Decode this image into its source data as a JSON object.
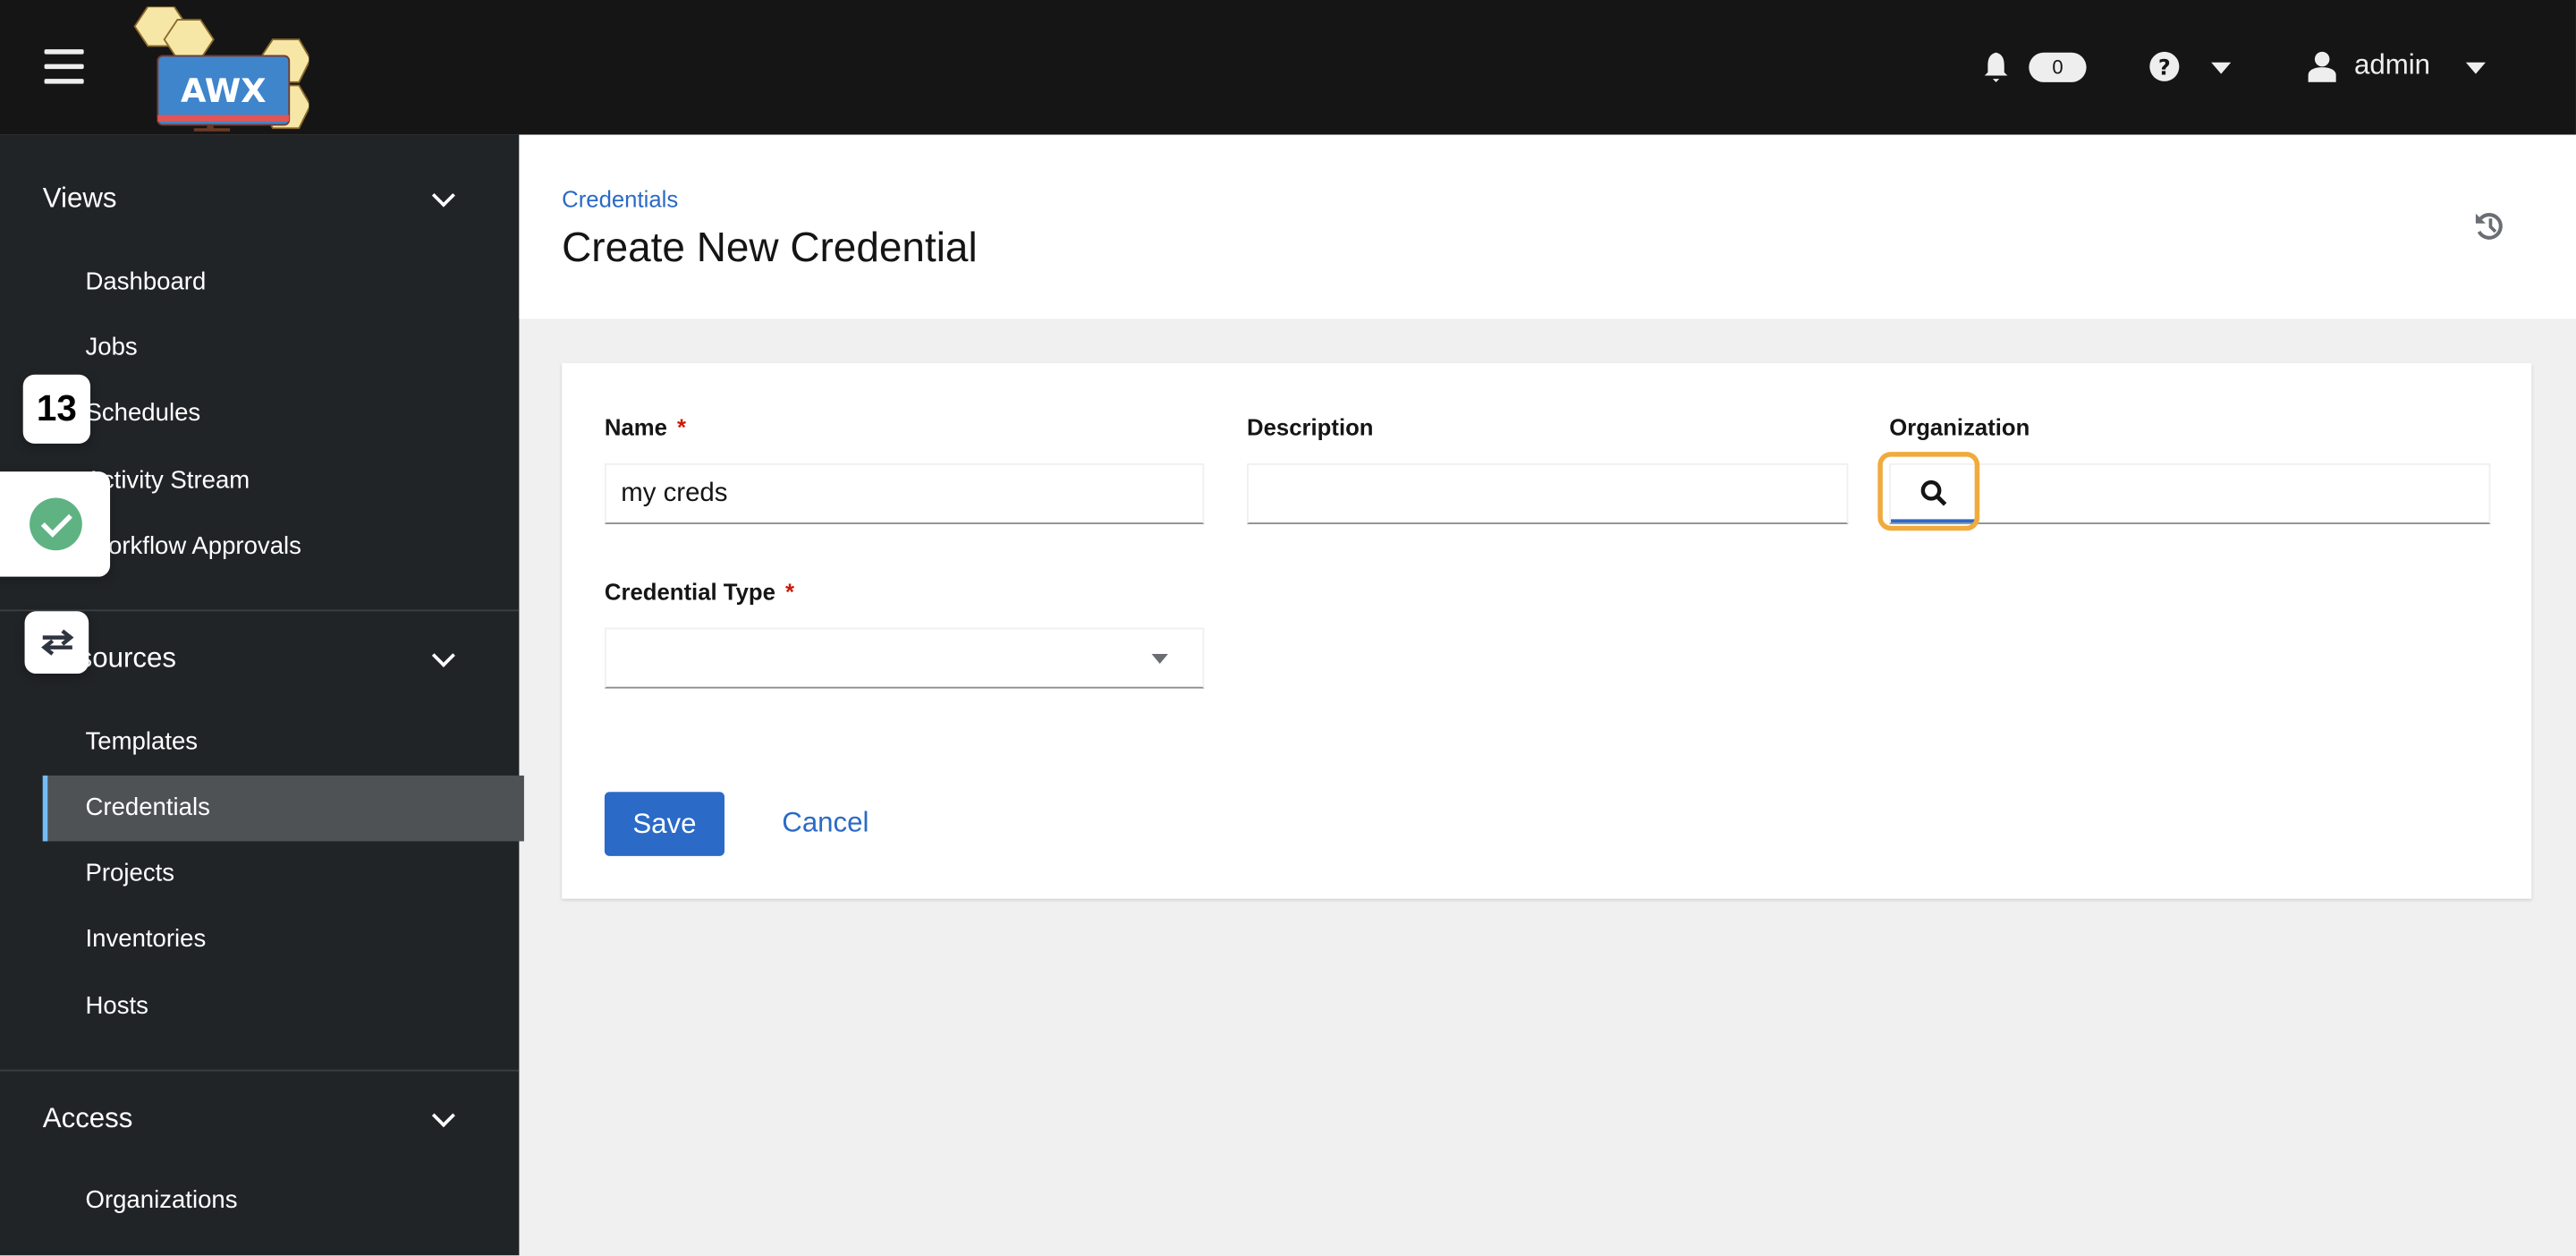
{
  "header": {
    "app_name": "AWX",
    "notifications_count": "0",
    "user": "admin"
  },
  "sidebar": {
    "groups": [
      {
        "label": "Views",
        "items": [
          "Dashboard",
          "Jobs",
          "Schedules",
          "Activity Stream",
          "Workflow Approvals"
        ]
      },
      {
        "label": "Resources",
        "items": [
          "Templates",
          "Credentials",
          "Projects",
          "Inventories",
          "Hosts"
        ]
      },
      {
        "label": "Access",
        "items": [
          "Organizations"
        ]
      }
    ],
    "active_item": "Credentials"
  },
  "page": {
    "breadcrumb": "Credentials",
    "title": "Create New Credential"
  },
  "form": {
    "name_label": "Name",
    "name_value": "my creds",
    "required_mark": "*",
    "description_label": "Description",
    "description_value": "",
    "organization_label": "Organization",
    "organization_value": "",
    "credential_type_label": "Credential Type",
    "credential_type_value": "",
    "save_label": "Save",
    "cancel_label": "Cancel"
  },
  "overlays": {
    "counter": "13"
  },
  "colors": {
    "accent": "#2b6ac6",
    "highlight": "#f0ab3c",
    "success": "#5fb383"
  }
}
